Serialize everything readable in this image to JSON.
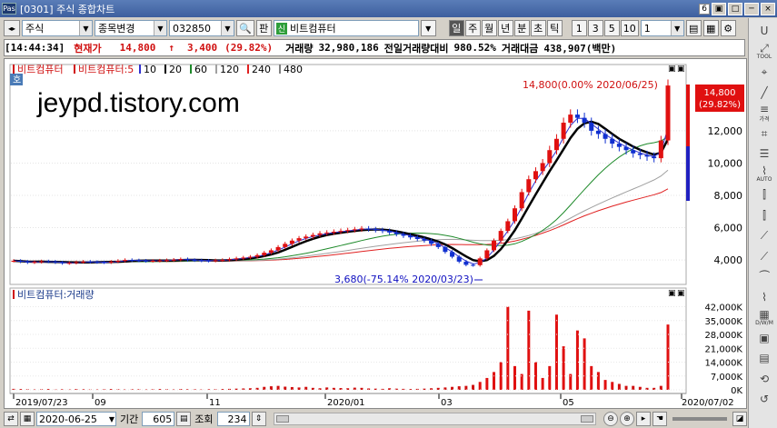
{
  "window": {
    "app_icon": "Pas",
    "title": "[0301] 주식 종합차트",
    "screen_number": "6",
    "controls": [
      "▣",
      "□",
      "─",
      "×"
    ]
  },
  "toolbar": {
    "market_type": "주식",
    "search_mode": "종목변경",
    "stock_code": "032850",
    "pan_label": "판",
    "stock_badge": "신",
    "stock_name": "비트컴퓨터",
    "periods": [
      {
        "label": "일",
        "active": true
      },
      {
        "label": "주",
        "active": false
      },
      {
        "label": "월",
        "active": false
      },
      {
        "label": "년",
        "active": false
      },
      {
        "label": "분",
        "active": false
      },
      {
        "label": "초",
        "active": false
      },
      {
        "label": "틱",
        "active": false
      }
    ],
    "units": [
      "1",
      "3",
      "5",
      "10"
    ],
    "unit_value": "1"
  },
  "price_bar": {
    "time": "[14:44:34]",
    "current_label": "현재가",
    "price": "14,800",
    "arrow": "↑",
    "change": "3,400",
    "change_pct": "(29.82%)",
    "volume_label": "거래량",
    "volume": "32,980,186",
    "prev_vol_label": "전일거래량대비",
    "prev_vol_pct": "980.52%",
    "amount_label": "거래대금",
    "amount": "438,907(백만)"
  },
  "legend": {
    "stock": "비트컴퓨터",
    "stock5": "비트컴퓨터:5",
    "ma": [
      {
        "label": "10",
        "color": "#3030d0"
      },
      {
        "label": "20",
        "color": "#000000"
      },
      {
        "label": "60",
        "color": "#1e8a2a"
      },
      {
        "label": "120",
        "color": "#a0a0a0"
      },
      {
        "label": "240",
        "color": "#e02020"
      },
      {
        "label": "480",
        "color": "#808080"
      }
    ],
    "ho_label": "호"
  },
  "annotations": {
    "high": "14,800(0.00% 2020/06/25)",
    "low": "3,680(-75.14% 2020/03/23)",
    "current_tag_price": "14,800",
    "current_tag_pct": "(29.82%)"
  },
  "watermark": "jeypd.tistory.com",
  "volume_panel": {
    "title": "비트컴퓨터:거래량"
  },
  "bottom": {
    "date": "2020-06-25",
    "period_label": "기간",
    "period_value": "605",
    "view_label": "조회",
    "view_value": "234"
  },
  "sidebar_buttons": [
    {
      "icon": "U",
      "label": ""
    },
    {
      "icon": "⤢",
      "label": "TOOL"
    },
    {
      "icon": "⌖",
      "label": ""
    },
    {
      "icon": "╱",
      "label": ""
    },
    {
      "icon": "≡",
      "label": "가격"
    },
    {
      "icon": "⌗",
      "label": ""
    },
    {
      "icon": "☰",
      "label": ""
    },
    {
      "icon": "⌇",
      "label": "AUTO"
    },
    {
      "icon": "⫿",
      "label": ""
    },
    {
      "icon": "⫿",
      "label": ""
    },
    {
      "icon": "⟋",
      "label": ""
    },
    {
      "icon": "⟋",
      "label": ""
    },
    {
      "icon": "⏜",
      "label": ""
    },
    {
      "icon": "⌇",
      "label": ""
    },
    {
      "icon": "▦",
      "label": "D/W/M"
    },
    {
      "icon": "▣",
      "label": ""
    },
    {
      "icon": "▤",
      "label": ""
    },
    {
      "icon": "⟲",
      "label": ""
    },
    {
      "icon": "↺",
      "label": ""
    }
  ],
  "chart_data": [
    {
      "type": "candlestick",
      "title": "",
      "x_ticks": [
        "2019/07/23",
        "09",
        "11",
        "2020/01",
        "03",
        "05",
        "2020/07/02"
      ],
      "y_ticks": [
        4000,
        6000,
        8000,
        10000,
        12000
      ],
      "ylim": [
        2600,
        15200
      ],
      "moving_averages": [
        "5",
        "10",
        "20",
        "60",
        "120",
        "240",
        "480"
      ],
      "close_series": [
        3950,
        3900,
        3850,
        3880,
        3920,
        3900,
        3850,
        3800,
        3820,
        3870,
        3900,
        3880,
        3860,
        3850,
        3900,
        3950,
        4000,
        3980,
        3960,
        3940,
        3950,
        3970,
        3990,
        4020,
        4050,
        4000,
        3980,
        3960,
        3950,
        3980,
        4000,
        4050,
        4100,
        4150,
        4200,
        4300,
        4450,
        4600,
        4800,
        5000,
        5200,
        5350,
        5450,
        5550,
        5650,
        5700,
        5750,
        5800,
        5850,
        5900,
        5950,
        5900,
        5850,
        5800,
        5700,
        5600,
        5500,
        5400,
        5300,
        5200,
        5000,
        4800,
        4500,
        4200,
        3900,
        3700,
        3680,
        4100,
        4600,
        5200,
        5800,
        6400,
        7200,
        8200,
        9000,
        9500,
        10000,
        10800,
        11500,
        12500,
        13000,
        12800,
        12500,
        12000,
        11800,
        11500,
        11200,
        11000,
        10800,
        10600,
        10500,
        10400,
        10300,
        11400,
        14800
      ],
      "volume_series_k": [
        0.5,
        0.4,
        0.3,
        0.2,
        0.3,
        0.4,
        0.2,
        0.3,
        0.2,
        0.4,
        0.3,
        0.2,
        0.2,
        0.3,
        0.4,
        0.3,
        0.2,
        0.3,
        0.3,
        0.2,
        0.3,
        0.4,
        0.3,
        0.2,
        0.4,
        0.3,
        0.3,
        0.2,
        0.3,
        0.3,
        0.4,
        0.5,
        0.6,
        0.7,
        0.8,
        1.0,
        1.5,
        1.8,
        2.0,
        1.6,
        1.4,
        1.2,
        1.5,
        1.0,
        0.8,
        1.2,
        1.0,
        0.9,
        0.8,
        1.1,
        1.0,
        0.7,
        0.6,
        0.5,
        0.8,
        0.6,
        0.5,
        0.4,
        0.5,
        0.6,
        0.8,
        1.0,
        1.2,
        1.5,
        1.8,
        2.0,
        2.5,
        4.0,
        6.0,
        9.0,
        14.0,
        42.0,
        12.0,
        8.0,
        40.0,
        14.0,
        6.0,
        12.0,
        38.0,
        22.0,
        8.0,
        30.0,
        26.0,
        12.0,
        9.0,
        5.0,
        4.0,
        3.0,
        2.0,
        2.0,
        1.5,
        1.0,
        1.0,
        2.0,
        33.0
      ],
      "volume_ylim": [
        0,
        45000
      ],
      "volume_y_ticks": [
        "0K",
        "7,000K",
        "14,000K",
        "21,000K",
        "28,000K",
        "35,000K",
        "42,000K"
      ]
    }
  ]
}
